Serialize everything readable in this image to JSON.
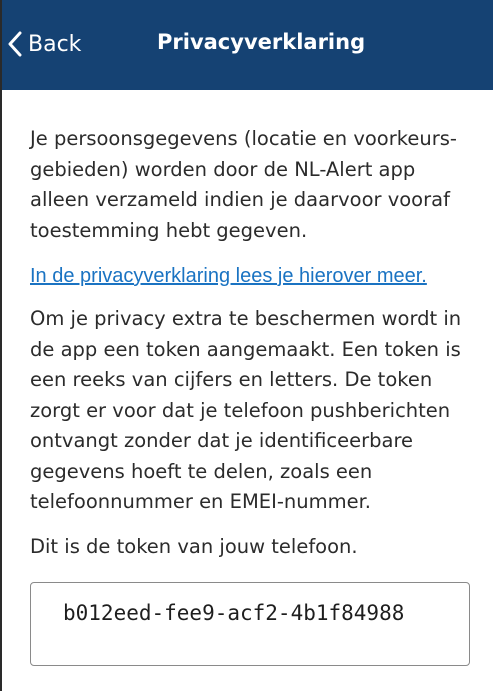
{
  "navbar": {
    "back_label": "Back",
    "title": "Privacyverklaring",
    "back_icon": "chevron-left-icon",
    "background_color": "#154273"
  },
  "content": {
    "intro": "Je persoonsgegevens (locatie en voorkeurs-gebieden) worden door de NL-Alert app alleen verzameld indien je daarvoor vooraf toestemming hebt gegeven.",
    "link_text": "In de privacyverklaring lees je hierover meer.",
    "body": "Om je privacy extra te beschermen wordt in de app een token aangemaakt. Een token is een reeks van cijfers en letters. De token zorgt er voor dat je telefoon pushberichten ontvangt zonder dat je identificeerbare gegevens hoeft te delen, zoals een telefoonnummer en EMEI-nummer.",
    "token_label": "Dit is de token van jouw telefoon.",
    "link_color": "#1a73c2"
  },
  "token": {
    "value": "b012eed-fee9-acf2-4b1f84988"
  }
}
